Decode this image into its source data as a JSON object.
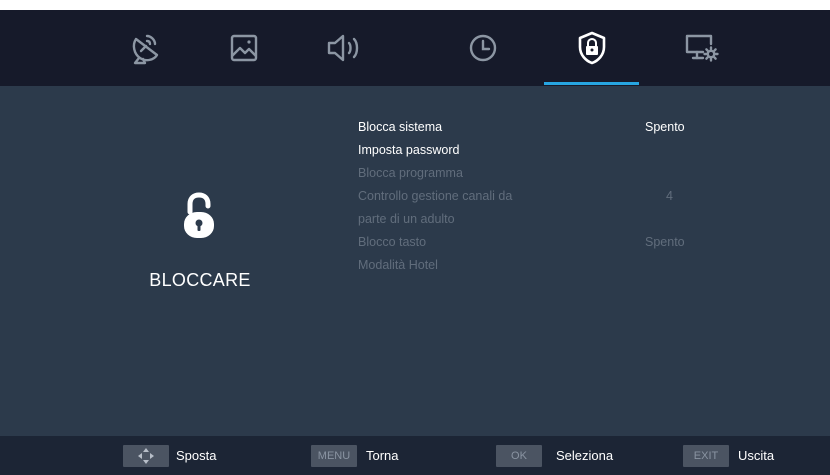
{
  "tabs": [
    {
      "icon": "satellite-dish-icon"
    },
    {
      "icon": "picture-icon"
    },
    {
      "icon": "speaker-icon"
    },
    {
      "icon": "clock-icon"
    },
    {
      "icon": "shield-lock-icon",
      "selected": true
    },
    {
      "icon": "monitor-settings-icon"
    }
  ],
  "colors": {
    "background": "#2c3a4b",
    "topbar": "#161a2a",
    "accent": "#27a5e1",
    "bottombar": "#1c2535",
    "disabled_text": "#616d7c"
  },
  "section": {
    "icon": "padlock-icon",
    "title": "BLOCCARE"
  },
  "menu": {
    "items": [
      {
        "label": "Blocca sistema",
        "value": "Spento",
        "enabled": true
      },
      {
        "label": "Imposta password",
        "value": "",
        "enabled": true
      },
      {
        "label": "Blocca programma",
        "value": "",
        "enabled": false
      },
      {
        "label": "Controllo gestione canali da",
        "value": "4",
        "enabled": false
      },
      {
        "label": "parte di un adulto",
        "value": "",
        "enabled": false
      },
      {
        "label": "Blocco tasto",
        "value": "Spento",
        "enabled": false
      },
      {
        "label": "Modalità Hotel",
        "value": "",
        "enabled": false
      }
    ]
  },
  "hints": {
    "move": {
      "key_icon": "dpad-icon",
      "label": "Sposta"
    },
    "back": {
      "key": "MENU",
      "label": "Torna"
    },
    "select": {
      "key": "OK",
      "label": "Seleziona"
    },
    "exit": {
      "key": "EXIT",
      "label": "Uscita"
    }
  }
}
